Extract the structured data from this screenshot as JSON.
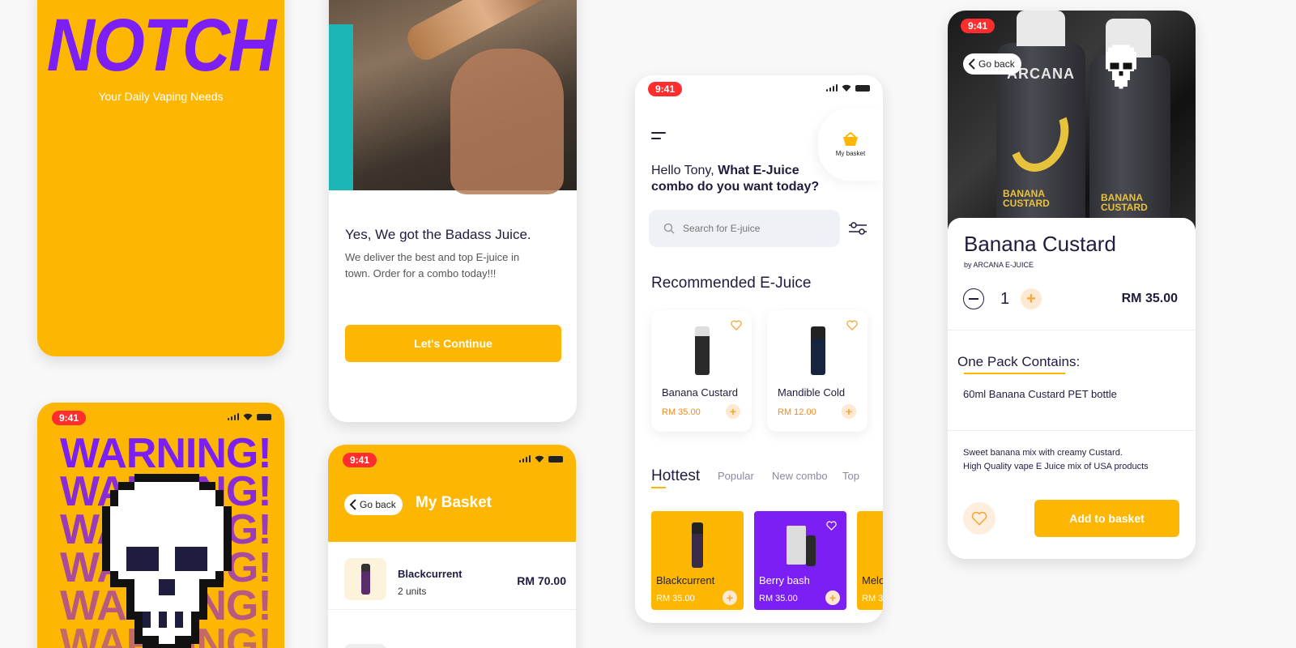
{
  "colors": {
    "accent": "#fdb703",
    "purple": "#7b1ff5",
    "ink": "#1f1d3d",
    "price": "#f08a24",
    "status": "#ff2d2d"
  },
  "splash": {
    "logo": "NOTCH",
    "tagline": "Your Daily Vaping Needs"
  },
  "warning_screen": {
    "time": "9:41",
    "word": "WARNING!"
  },
  "onboarding": {
    "headline": "Yes, We got the Badass Juice.",
    "body": "We deliver the best and top E-juice in town. Order for a combo today!!!",
    "cta": "Let's Continue"
  },
  "basket_screen": {
    "time": "9:41",
    "back": "Go back",
    "title": "My Basket",
    "items": [
      {
        "name": "Blackcurrent",
        "units": "2 units",
        "price": "RM 70.00"
      }
    ]
  },
  "home": {
    "time": "9:41",
    "basket_label": "My basket",
    "greeting_plain": "Hello Tony, ",
    "greeting_bold_1": "What E-Juice",
    "greeting_bold_2": "combo do you want today?",
    "search_placeholder": "Search for E-juice",
    "recommended_title": "Recommended E-Juice",
    "recommended": [
      {
        "name": "Banana Custard",
        "price": "RM 35.00"
      },
      {
        "name": "Mandible Cold",
        "price": "RM 12.00"
      }
    ],
    "tabs": [
      "Hottest",
      "Popular",
      "New combo",
      "Top"
    ],
    "hottest": [
      {
        "name": "Blackcurrent",
        "price": "RM 35.00",
        "color": "#fdb703"
      },
      {
        "name": "Berry bash",
        "price": "RM 35.00",
        "color": "#7b1ff5"
      },
      {
        "name": "Melo",
        "price": "RM 3",
        "color": "#fdb703"
      }
    ]
  },
  "detail": {
    "time": "9:41",
    "back": "Go back",
    "name": "Banana Custard",
    "brand": "by ARCANA E-JUICE",
    "quantity": "1",
    "price": "RM 35.00",
    "contains_title": "One Pack Contains:",
    "contains_item": "60ml Banana Custard PET bottle",
    "desc_1": "Sweet banana mix with creamy Custard.",
    "desc_2": "High Quality vape E Juice mix of USA products",
    "add_button": "Add to basket",
    "bottle_label": "ARCANA",
    "bottle_flavor": "BANANA CUSTARD"
  }
}
